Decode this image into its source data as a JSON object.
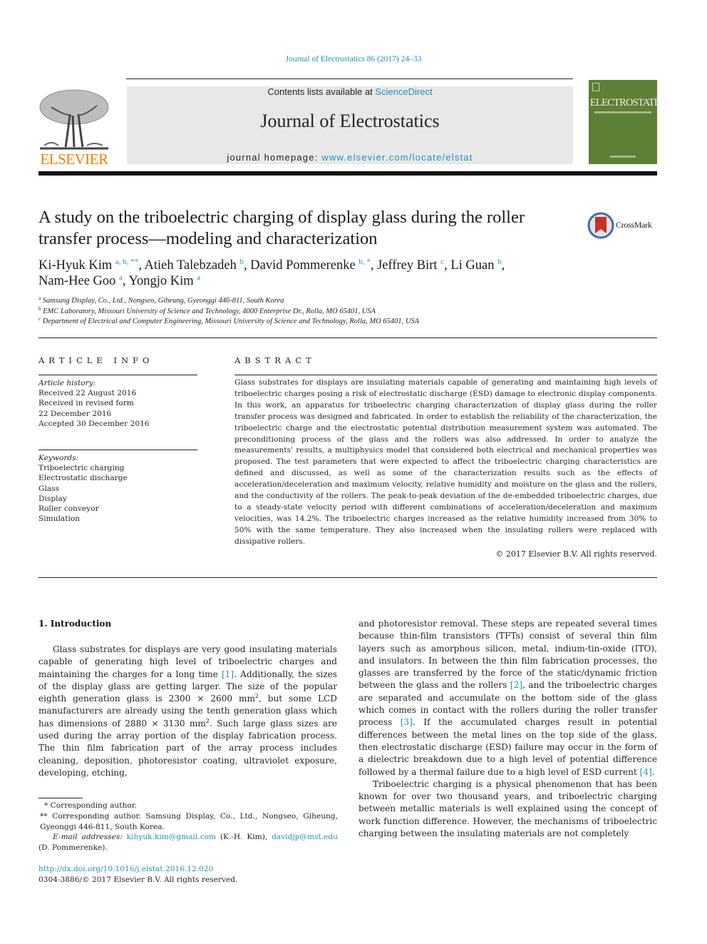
{
  "header": {
    "journal_reference": "Journal of Electrostatics 86 (2017) 24–33",
    "contents_prefix": "Contents lists available at ",
    "contents_link": "ScienceDirect",
    "journal_title": "Journal of Electrostatics",
    "homepage_prefix": "journal homepage: ",
    "homepage_link": "www.elsevier.com/locate/elstat",
    "publisher_logo_text": "ELSEVIER",
    "cover_title": "ELECTROSTATICS",
    "brand_colors": {
      "link": "#1f8fc4",
      "elsevier_orange": "#f07c00",
      "cover_green": "#5e7f35"
    }
  },
  "article": {
    "title": "A study on the triboelectric charging of display glass during the roller transfer process—modeling and characterization",
    "crossmark_label": "CrossMark",
    "authors": [
      {
        "name": "Ki-Hyuk Kim",
        "sup": "a, b, **"
      },
      {
        "name": "Atieh Talebzadeh",
        "sup": "b"
      },
      {
        "name": "David Pommerenke",
        "sup": "b, *"
      },
      {
        "name": "Jeffrey Birt",
        "sup": "c"
      },
      {
        "name": "Li Guan",
        "sup": "b"
      },
      {
        "name": "Nam-Hee Goo",
        "sup": "a"
      },
      {
        "name": "Yongjo Kim",
        "sup": "a"
      }
    ],
    "affiliations": [
      {
        "key": "a",
        "text": "Samsung Display, Co., Ltd., Nongseo, Giheung, Gyeonggi 446-811, South Korea"
      },
      {
        "key": "b",
        "text": "EMC Laboratory, Missouri University of Science and Technology, 4000 Enterprise Dr., Rolla, MO 65401, USA"
      },
      {
        "key": "c",
        "text": "Department of Electrical and Computer Engineering, Missouri University of Science and Technology, Rolla, MO 65401, USA"
      }
    ]
  },
  "article_info": {
    "heading": "ARTICLE INFO",
    "history_label": "Article history:",
    "history": [
      "Received 22 August 2016",
      "Received in revised form",
      "22 December 2016",
      "Accepted 30 December 2016"
    ],
    "keywords_label": "Keywords:",
    "keywords": [
      "Triboelectric charging",
      "Electrostatic discharge",
      "Glass",
      "Display",
      "Roller conveyor",
      "Simulation"
    ]
  },
  "abstract": {
    "heading": "ABSTRACT",
    "text": "Glass substrates for displays are insulating materials capable of generating and maintaining high levels of triboelectric charges posing a risk of electrostatic discharge (ESD) damage to electronic display components. In this work, an apparatus for triboelectric charging characterization of display glass during the roller transfer process was designed and fabricated. In order to establish the reliability of the characterization, the triboelectric charge and the electrostatic potential distribution measurement system was automated. The preconditioning process of the glass and the rollers was also addressed. In order to analyze the measurements' results, a multiphysics model that considered both electrical and mechanical properties was proposed. The test parameters that were expected to affect the triboelectric charging characteristics are defined and discussed, as well as some of the characterization results such as the effects of acceleration/deceleration and maximum velocity, relative humidity and moisture on the glass and the rollers, and the conductivity of the rollers. The peak-to-peak deviation of the de-embedded triboelectric charges, due to a steady-state velocity period with different combinations of acceleration/deceleration and maximum velocities, was 14.2%. The triboelectric charges increased as the relative humidity increased from 30% to 50% with the same temperature. They also increased when the insulating rollers were replaced with dissipative rollers.",
    "copyright": "© 2017 Elsevier B.V. All rights reserved."
  },
  "body": {
    "section_heading": "1.  Introduction",
    "left_col": {
      "p1_a": "Glass substrates for displays are very good insulating materials capable of generating high level of triboelectric charges and maintaining the charges for a long time ",
      "ref1": "[1]",
      "p1_b": ". Additionally, the sizes of the display glass are getting larger. The size of the popular eighth generation glass is 2300 × 2600 mm",
      "sup2a": "2",
      "p1_c": ", but some LCD manufacturers are already using the tenth generation glass which has dimensions of 2880 × 3130 mm",
      "sup2b": "2",
      "p1_d": ". Such large glass sizes are used during the array portion of the display fabrication process. The thin film fabrication part of the array process includes cleaning, deposition, photoresistor coating, ultraviolet exposure, developing, etching,"
    },
    "right_col": {
      "p1_a": "and photoresistor removal. These steps are repeated several times because thin-film transistors (TFTs) consist of several thin film layers such as amorphous silicon, metal, indium-tin-oxide (ITO), and insulators. In between the thin film fabrication processes, the glasses are transferred by the force of the static/dynamic friction between the glass and the rollers ",
      "ref2": "[2]",
      "p1_b": ", and the triboelectric charges are separated and accumulate on the bottom side of the glass which comes in contact with the rollers during the roller transfer process ",
      "ref3": "[3]",
      "p1_c": ". If the accumulated charges result in potential differences between the metal lines on the top side of the glass, then electrostatic discharge (ESD) failure may occur in the form of a dielectric breakdown due to a high level of potential difference followed by a thermal failure due to a high level of ESD current ",
      "ref4": "[4]",
      "p1_d": ".",
      "p2": "Triboelectric charging is a physical phenomenon that has been known for over two thousand years, and triboelectric charging between metallic materials is well explained using the concept of work function difference. However, the mechanisms of triboelectric charging between the insulating materials are not completely"
    }
  },
  "footnotes": {
    "star1": "* Corresponding author.",
    "star2": "** Corresponding author. Samsung Display, Co., Ltd., Nongseo, Giheung, Gyeonggi 446-811, South Korea.",
    "email_label": "E-mail addresses:",
    "email1": "kihyuk.kim@gmail.com",
    "email1_owner": " (K.-H. Kim), ",
    "email2": "davidjp@mst.edu",
    "email2_owner": " (D. Pommerenke).",
    "doi": "http://dx.doi.org/10.1016/j.elstat.2016.12.020",
    "issn": "0304-3886/© 2017 Elsevier B.V. All rights reserved."
  }
}
